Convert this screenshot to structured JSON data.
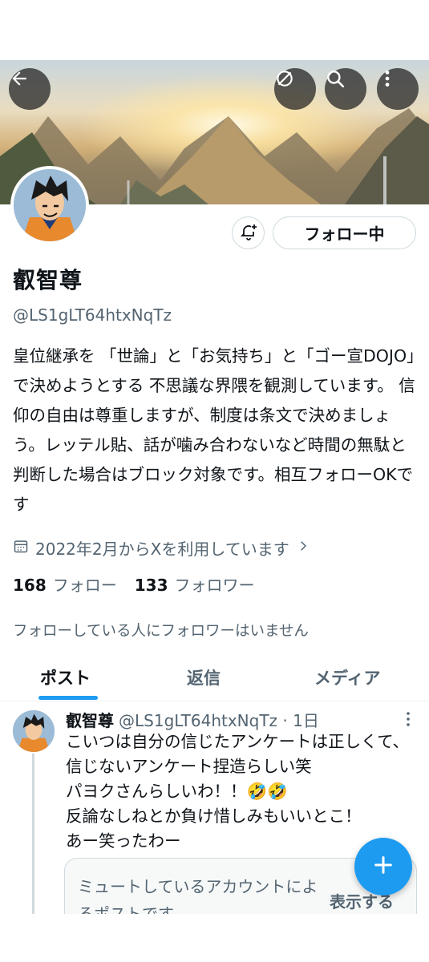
{
  "profile": {
    "name": "叡智尊",
    "handle": "@LS1gLT64htxNqTz",
    "bio": "皇位継承を 「世論」と「お気持ち」と「ゴー宣DOJO」で決めようとする 不思議な界隈を観測しています。 信仰の自由は尊重しますが、制度は条文で決めましょう。レッテル貼、話が噛み合わないなど時間の無駄と判断した場合はブロック対象です。相互フォローOKです",
    "joined": "2022年2月からXを利用しています",
    "following_count": "168",
    "following_label": "フォロー",
    "followers_count": "133",
    "followers_label": "フォロワー",
    "no_mutual_text": "フォローしている人にフォロワーはいません"
  },
  "actions": {
    "follow_button": "フォロー中"
  },
  "tabs": [
    {
      "label": "ポスト",
      "active": true
    },
    {
      "label": "返信",
      "active": false
    },
    {
      "label": "メディア",
      "active": false
    }
  ],
  "post": {
    "author_name": "叡智尊",
    "meta": "@LS1gLT64htxNqTz · 1日",
    "text": "こいつは自分の信じたアンケートは正しくて、信じないアンケート捏造らしい笑\nパヨクさんらしいわ！！🤣🤣\n反論なしねとか負け惜しみもいいとこ！\nあー笑ったわー",
    "muted_text": "ミュートしているアカウントによるポストです",
    "muted_action": "表示する"
  },
  "icons": {
    "back": "back-arrow-icon",
    "hide": "eye-slash-icon",
    "search": "search-icon",
    "more": "more-vertical-icon",
    "bell": "bell-plus-icon",
    "calendar": "calendar-icon",
    "chevron": "chevron-right-icon",
    "compose": "plus-icon"
  },
  "colors": {
    "accent": "#1d9bf0",
    "text": "#0f1419",
    "secondary": "#536471",
    "border": "#cfd9de"
  }
}
